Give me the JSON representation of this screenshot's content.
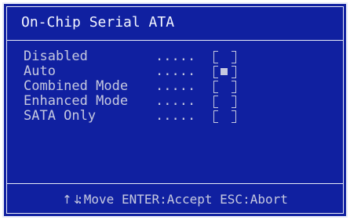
{
  "dialog": {
    "title": "On-Chip Serial ATA"
  },
  "options": [
    {
      "label": "Disabled",
      "dots": ".....",
      "selected": false
    },
    {
      "label": "Auto",
      "dots": ".....",
      "selected": true
    },
    {
      "label": "Combined Mode",
      "dots": ".....",
      "selected": false
    },
    {
      "label": "Enhanced Mode",
      "dots": ".....",
      "selected": false
    },
    {
      "label": "SATA Only",
      "dots": ".....",
      "selected": false
    }
  ],
  "footer": {
    "arrows": "↑↓",
    "hint": ":Move ENTER:Accept ESC:Abort"
  },
  "colors": {
    "background": "#1020a0",
    "text": "#c6c9e0",
    "title": "#f4f6ff",
    "border": "#e8ecf8"
  }
}
